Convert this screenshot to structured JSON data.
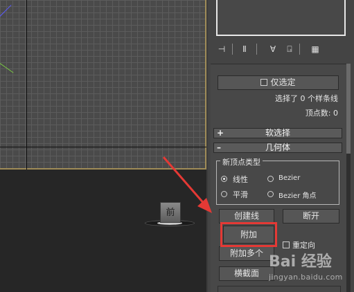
{
  "viewport": {
    "viewcube_label": "前"
  },
  "toolbar": {
    "tools": [
      {
        "icon": "pin-icon",
        "glyph": "⊣"
      },
      {
        "icon": "modifier-stack-icon",
        "glyph": "Ⅱ"
      },
      {
        "icon": "vertex-select-icon",
        "glyph": "∀"
      },
      {
        "icon": "lock-icon",
        "glyph": "⍈"
      },
      {
        "icon": "configure-icon",
        "glyph": "▦"
      }
    ]
  },
  "selection": {
    "only_selected_label": "仅选定",
    "selected_info": "选择了 0 个样条线",
    "vertex_count": "顶点数: 0"
  },
  "soft_selection": {
    "sign": "+",
    "title": "软选择"
  },
  "geometry": {
    "sign": "–",
    "title": "几何体",
    "new_vertex_type": {
      "title": "新顶点类型",
      "options": [
        {
          "label": "线性",
          "selected": true
        },
        {
          "label": "Bezier",
          "selected": false
        },
        {
          "label": "平滑",
          "selected": false
        },
        {
          "label": "Bezier 角点",
          "selected": false
        }
      ]
    },
    "create_line_label": "创建线",
    "break_label": "断开",
    "attach_label": "附加",
    "reorient_label": "重定向",
    "attach_multiple_label": "附加多个",
    "cross_section_label": "横截面"
  },
  "watermark": {
    "brand": "Bai 经验",
    "url": "jingyan.baidu.com"
  },
  "colors": {
    "highlight": "#e53935",
    "arrow": "#e53935",
    "panel_bg": "#444444",
    "grid_border": "#a08c58"
  }
}
